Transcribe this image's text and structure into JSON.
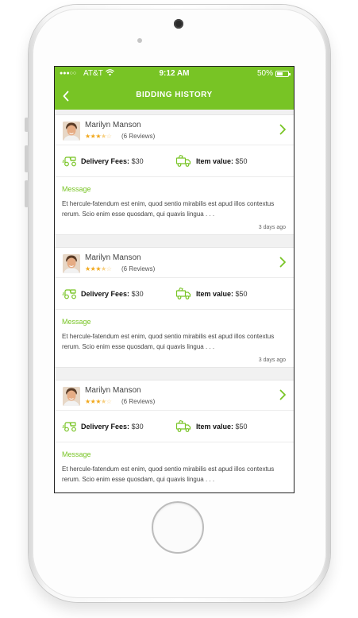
{
  "status_bar": {
    "signal": "●●●○○",
    "carrier": "AT&T",
    "time": "9:12 AM",
    "battery": "50%",
    "battery_level": 0.5
  },
  "header": {
    "back_icon": "chevron-left-icon",
    "title": "BIDDING HISTORY"
  },
  "colors": {
    "accent": "#78c425",
    "star": "#f1a81c"
  },
  "bids": [
    {
      "name": "Marilyn Manson",
      "rating": 3.5,
      "reviews": "(6 Reviews)",
      "delivery_label": "Delivery Fees:",
      "delivery_value": "$30",
      "item_label": "Item value:",
      "item_value": "$50",
      "message_title": "Message",
      "message": "Et hercule-fatendum est enim, quod sentio mirabilis est apud illos contextus rerum. Scio enim esse quosdam, qui quavis lingua . . .",
      "time": "3 days ago"
    },
    {
      "name": "Marilyn Manson",
      "rating": 3.5,
      "reviews": "(6 Reviews)",
      "delivery_label": "Delivery Fees:",
      "delivery_value": "$30",
      "item_label": "Item value:",
      "item_value": "$50",
      "message_title": "Message",
      "message": "Et hercule-fatendum est enim, quod sentio mirabilis est apud illos contextus rerum. Scio enim esse quosdam, qui quavis lingua . . .",
      "time": "3 days ago"
    },
    {
      "name": "Marilyn Manson",
      "rating": 3.5,
      "reviews": "(6 Reviews)",
      "delivery_label": "Delivery Fees:",
      "delivery_value": "$30",
      "item_label": "Item value:",
      "item_value": "$50",
      "message_title": "Message",
      "message": "Et hercule-fatendum est enim, quod sentio mirabilis est apud illos contextus rerum. Scio enim esse quosdam, qui quavis lingua . . .",
      "time": ""
    }
  ]
}
